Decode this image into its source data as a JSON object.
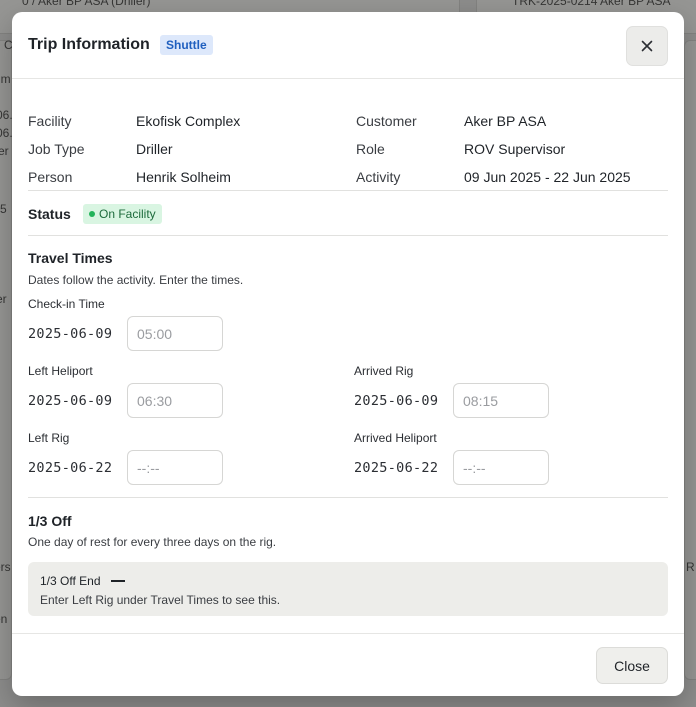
{
  "modal": {
    "title": "Trip Information",
    "badge": "Shuttle",
    "close_icon": "close-icon"
  },
  "info": {
    "facility_label": "Facility",
    "facility_value": "Ekofisk Complex",
    "job_type_label": "Job Type",
    "job_type_value": "Driller",
    "person_label": "Person",
    "person_value": "Henrik Solheim",
    "customer_label": "Customer",
    "customer_value": "Aker BP ASA",
    "role_label": "Role",
    "role_value": "ROV Supervisor",
    "activity_label": "Activity",
    "activity_value": "09 Jun 2025 - 22 Jun 2025"
  },
  "status": {
    "label": "Status",
    "value": "On Facility",
    "color": "#22b35a"
  },
  "travel": {
    "title": "Travel Times",
    "description": "Dates follow the activity. Enter the times.",
    "checkin": {
      "label": "Check-in Time",
      "date": "2025-06-09",
      "placeholder": "05:00"
    },
    "left_heliport": {
      "label": "Left Heliport",
      "date": "2025-06-09",
      "placeholder": "06:30"
    },
    "arrived_rig": {
      "label": "Arrived Rig",
      "date": "2025-06-09",
      "placeholder": "08:15"
    },
    "left_rig": {
      "label": "Left Rig",
      "date": "2025-06-22",
      "placeholder": "--:--"
    },
    "arrived_heliport": {
      "label": "Arrived Heliport",
      "date": "2025-06-22",
      "placeholder": "--:--"
    }
  },
  "third_off": {
    "title": "1/3 Off",
    "description": "One day of rest for every three days on the rig.",
    "end_label": "1/3 Off End",
    "hint": "Enter Left Rig under Travel Times to see this."
  },
  "footer": {
    "close_label": "Close"
  },
  "background": {
    "fragments": [
      "0 / Aker BP ASA (Driller)",
      "TRK-2025-0214 Aker BP ASA",
      "l C",
      "im",
      "06.",
      "06.",
      "er",
      "5",
      "er",
      "ers",
      "R",
      "en"
    ]
  },
  "colors": {
    "badge_blue": "#1f5fbf",
    "badge_blue_bg": "#dde8fb",
    "status_green_bg": "#d9f5e2"
  }
}
